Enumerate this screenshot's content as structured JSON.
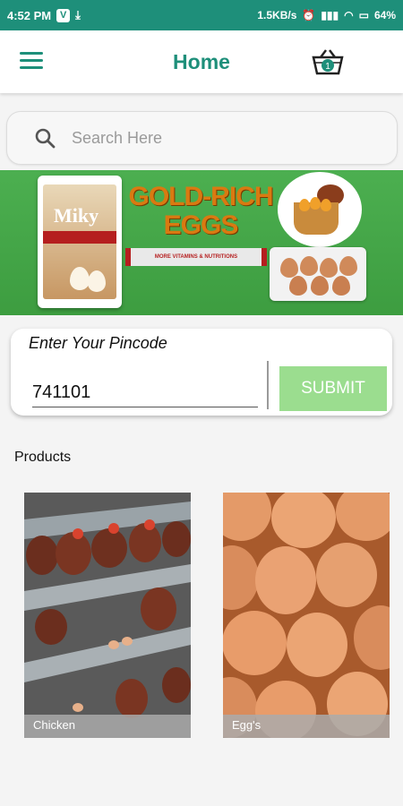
{
  "status_bar": {
    "time": "4:52 PM",
    "speed": "1.5KB/s",
    "battery": "64%"
  },
  "header": {
    "title": "Home",
    "cart_count": "1"
  },
  "search": {
    "placeholder": "Search Here"
  },
  "banner": {
    "title_line1": "GOLD-RICH",
    "title_line2": "EGGS",
    "tagline": "MORE VITAMINS & NUTRITIONS",
    "pack_brand": "Miky"
  },
  "pincode": {
    "label": "Enter Your Pincode",
    "value": "741101",
    "submit_label": "SUBMIT"
  },
  "products": {
    "heading": "Products",
    "items": [
      {
        "label": "Chicken"
      },
      {
        "label": "Egg's"
      }
    ]
  },
  "colors": {
    "brand": "#1e8f7a",
    "submit": "#9bdd8f",
    "banner": "#4caf50"
  }
}
